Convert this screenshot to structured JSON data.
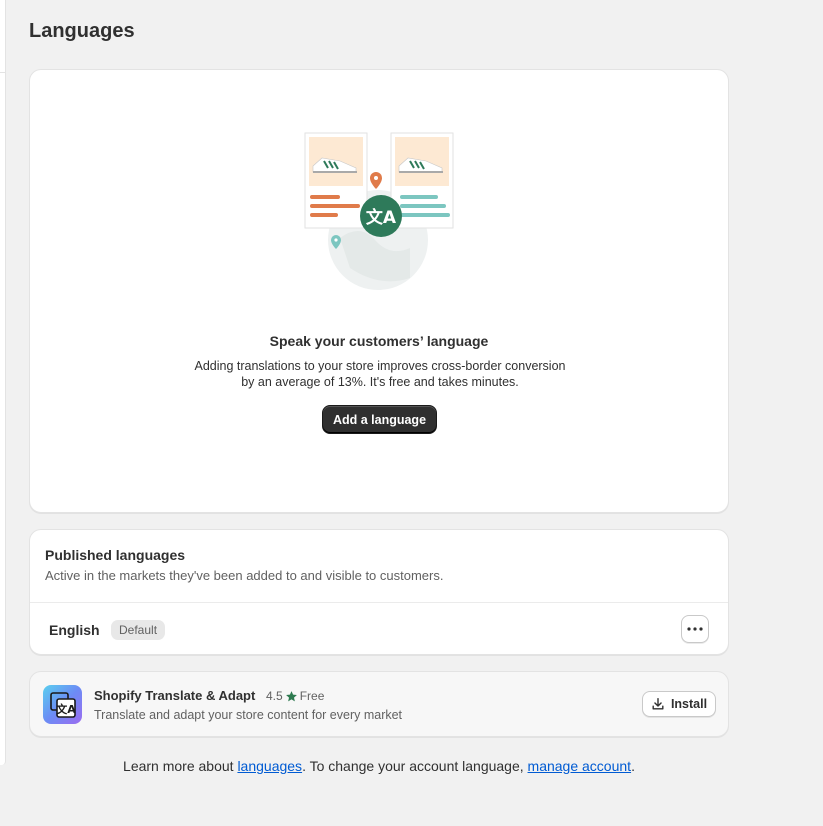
{
  "page": {
    "title": "Languages"
  },
  "hero": {
    "title": "Speak your customers’ language",
    "description_line1": "Adding translations to your store improves cross-border conversion",
    "description_line2": "by an average of 13%. It's free and takes minutes.",
    "button_label": "Add a language",
    "illustration_icon": "translate-icon"
  },
  "published": {
    "title": "Published languages",
    "description": "Active in the markets they've been added to and visible to customers.",
    "languages": [
      {
        "name": "English",
        "badge": "Default"
      }
    ],
    "more_icon": "ellipsis-icon"
  },
  "app": {
    "name": "Shopify Translate & Adapt",
    "rating": "4.5",
    "price": "Free",
    "description": "Translate and adapt your store content for every market",
    "install_label": "Install",
    "star_color": "#2d7a4f"
  },
  "footer": {
    "prefix": "Learn more about ",
    "link1": "languages",
    "middle": ". To change your account language, ",
    "link2": "manage account",
    "suffix": "."
  },
  "colors": {
    "background": "#f1f1f1",
    "primary_button": "#303030",
    "link": "#005bd3",
    "accent_green": "#2e7a5a",
    "accent_orange": "#e07b4a",
    "accent_teal": "#7cc6c0"
  }
}
